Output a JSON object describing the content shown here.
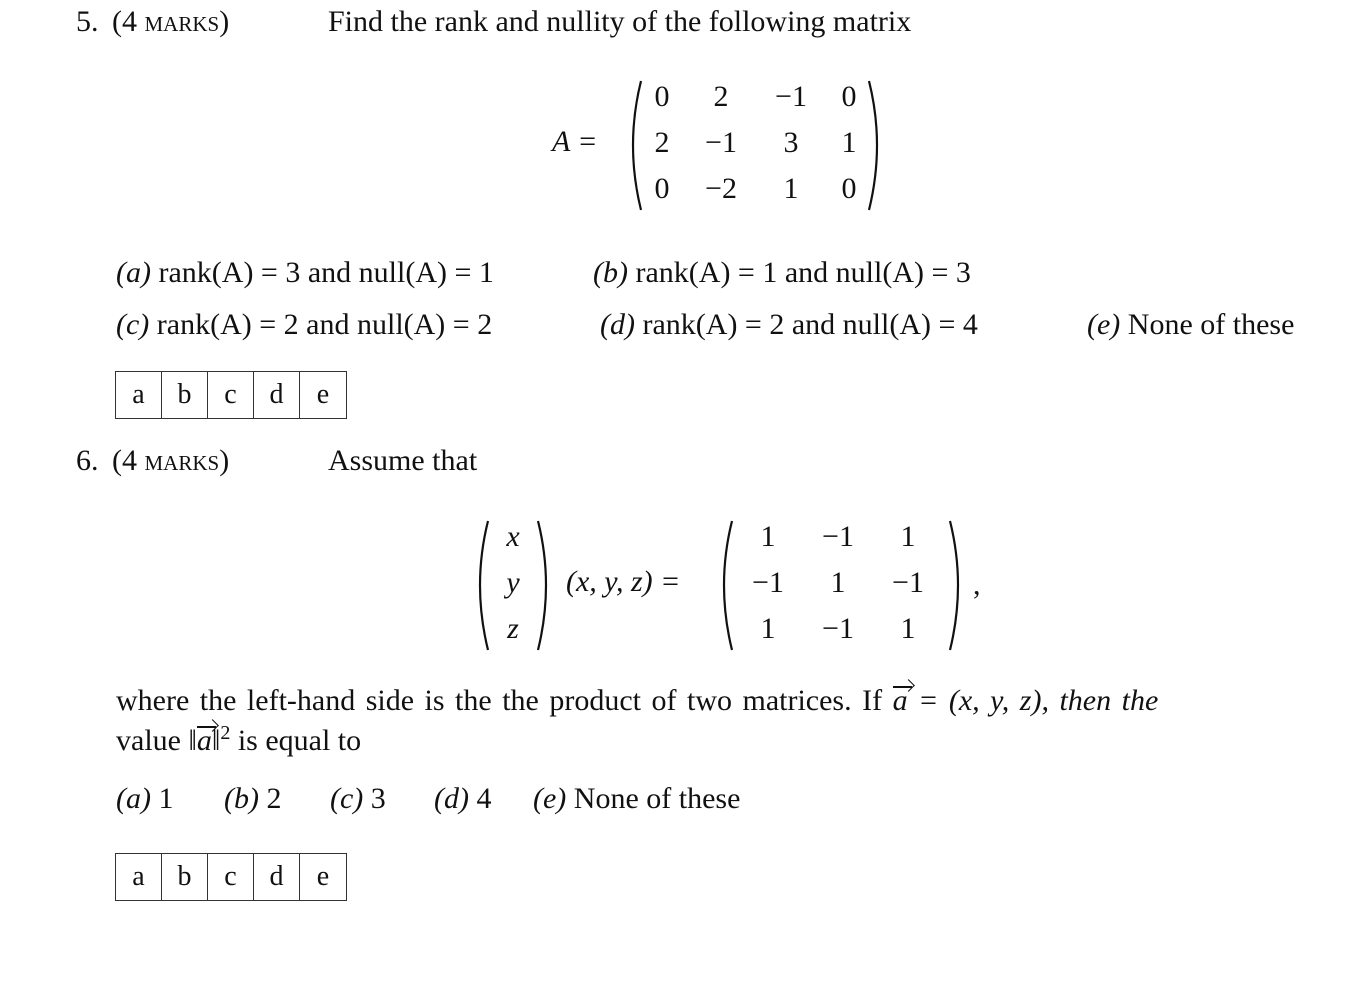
{
  "q5": {
    "number": "5.",
    "marks_open": "(4 ",
    "marks_word": "marks",
    "marks_close": ")",
    "prompt": "Find the rank and nullity of the following matrix",
    "matrix_label": "A =",
    "matrix": [
      [
        "0",
        "2",
        "−1",
        "0"
      ],
      [
        "2",
        "−1",
        "3",
        "1"
      ],
      [
        "0",
        "−2",
        "1",
        "0"
      ]
    ],
    "options": [
      {
        "letter": "(a)",
        "text": " rank(A) = 3 and null(A) = 1"
      },
      {
        "letter": "(b)",
        "text": " rank(A) = 1 and null(A) = 3"
      },
      {
        "letter": "(c)",
        "text": " rank(A) = 2 and null(A) = 2"
      },
      {
        "letter": "(d)",
        "text": " rank(A) = 2 and null(A) = 4"
      },
      {
        "letter": "(e)",
        "text": " None of these"
      }
    ],
    "answer_boxes": [
      "a",
      "b",
      "c",
      "d",
      "e"
    ]
  },
  "q6": {
    "number": "6.",
    "marks_open": "(4 ",
    "marks_word": "marks",
    "marks_close": ")",
    "prompt": "Assume that",
    "col_vector": [
      "x",
      "y",
      "z"
    ],
    "row_vector": "(x, y, z) =",
    "rhs_matrix": [
      [
        "1",
        "−1",
        "1"
      ],
      [
        "−1",
        "1",
        "−1"
      ],
      [
        "1",
        "−1",
        "1"
      ]
    ],
    "comma": ",",
    "line1_a": "where the left-hand side is the the product of two matrices.  If ",
    "vec_symbol": "a",
    "line1_b": " = (x, y, z), then the",
    "line2_a": "value ‖",
    "line2_b": "‖",
    "line2_sup": "2",
    "line2_c": " is equal to",
    "options": [
      {
        "letter": "(a)",
        "text": " 1"
      },
      {
        "letter": "(b)",
        "text": " 2"
      },
      {
        "letter": "(c)",
        "text": " 3"
      },
      {
        "letter": "(d)",
        "text": " 4"
      },
      {
        "letter": "(e)",
        "text": " None of these"
      }
    ],
    "answer_boxes": [
      "a",
      "b",
      "c",
      "d",
      "e"
    ]
  }
}
